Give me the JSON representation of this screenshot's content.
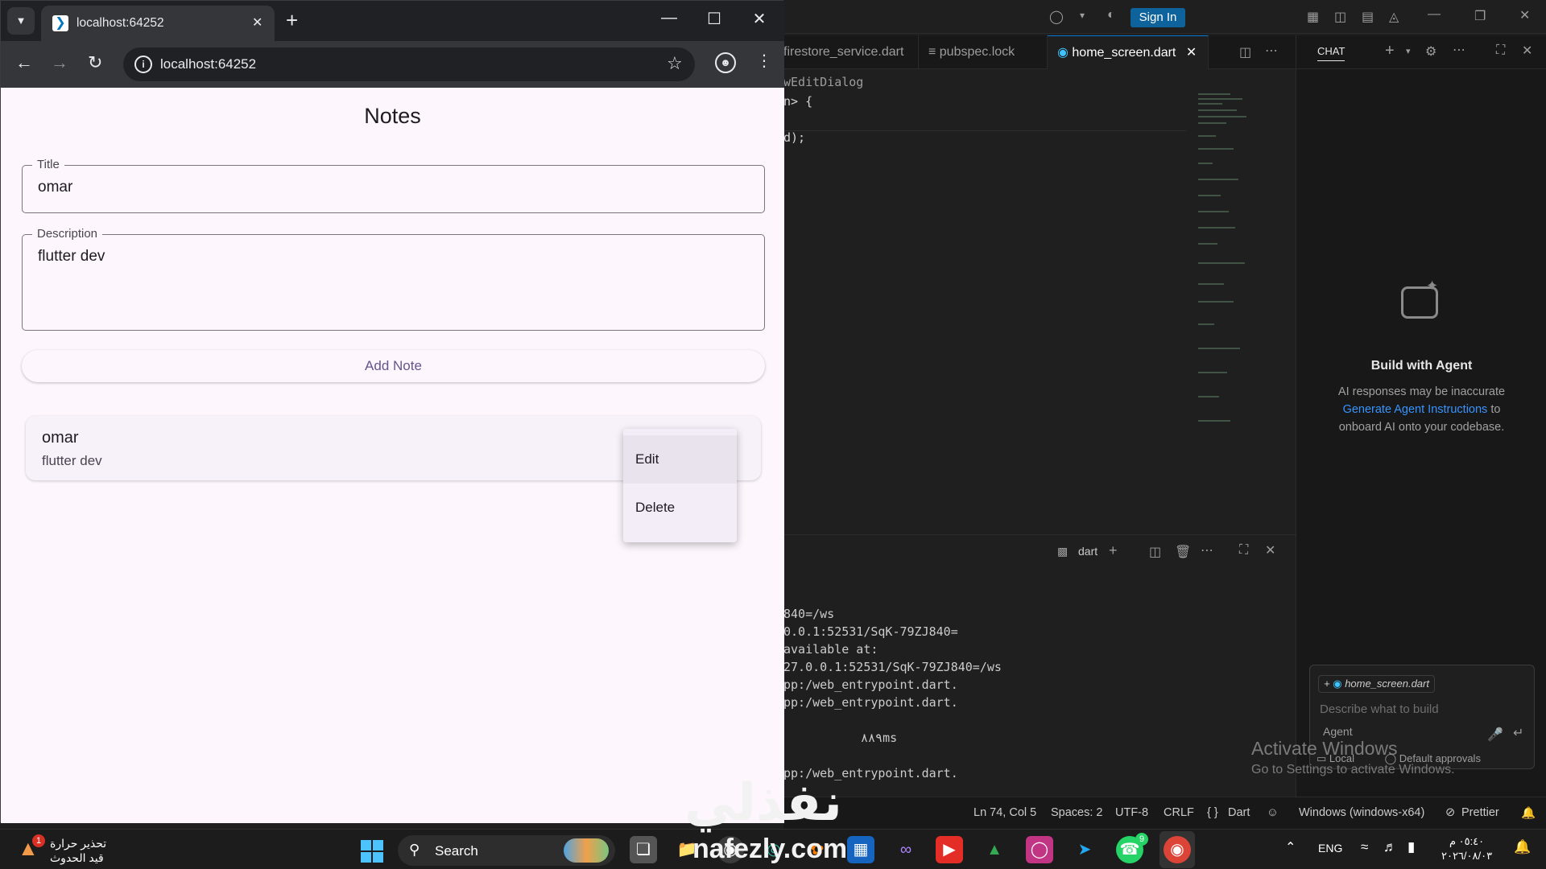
{
  "browser": {
    "tab_title": "localhost:64252",
    "url": "localhost:64252"
  },
  "app": {
    "title": "Notes",
    "title_field": {
      "label": "Title",
      "value": "omar"
    },
    "description_field": {
      "label": "Description",
      "value": "flutter dev"
    },
    "add_button_label": "Add Note",
    "notes": [
      {
        "title": "omar",
        "description": "flutter dev"
      }
    ],
    "popup_menu": {
      "edit_label": "Edit",
      "delete_label": "Delete"
    }
  },
  "vscode": {
    "sign_in_label": "Sign In",
    "tabs": [
      "firestore_service.dart",
      "pubspec.lock",
      "home_screen.dart"
    ],
    "code_lines": [
      "wEditDialog",
      "n> {",
      "d);"
    ],
    "terminal_shell": "dart",
    "terminal_lines": [
      "840=/ws",
      "0.0.1:52531/SqK-79ZJ840=",
      "available at:",
      "27.0.0.1:52531/SqK-79ZJ840=/ws",
      "pp:/web_entrypoint.dart.",
      "pp:/web_entrypoint.dart.",
      "٨٨٩ms",
      "pp:/web_entrypoint.dart."
    ],
    "chat": {
      "tab_label": "CHAT",
      "heading": "Build with Agent",
      "desc_before": "AI responses may be inaccurate",
      "desc_link": "Generate Agent Instructions",
      "desc_after": "to onboard AI onto your codebase.",
      "file_chip": "home_screen.dart",
      "placeholder": "Describe what to build",
      "mode_label": "Agent",
      "local_label": "Local",
      "approvals_label": "Default approvals"
    },
    "watermark_title": "Activate Windows",
    "watermark_sub": "Go to Settings to activate Windows.",
    "status": {
      "position": "Ln 74, Col 5",
      "spaces": "Spaces: 2",
      "encoding": "UTF-8",
      "eol": "CRLF",
      "language": "Dart",
      "platform": "Windows (windows-x64)",
      "formatter": "Prettier"
    }
  },
  "taskbar": {
    "weather_title": "تحذير حرارة",
    "weather_sub": "قيد الحدوث",
    "weather_badge": "1",
    "search_label": "Search",
    "language": "ENG",
    "time": "٠٥:٤٠ م",
    "date": "٢٠٢٦/٠٨/٠٣",
    "whatsapp_badge": "9"
  },
  "overlay": {
    "logo_text": "نفذلي",
    "url_text": "nafezly.com"
  }
}
